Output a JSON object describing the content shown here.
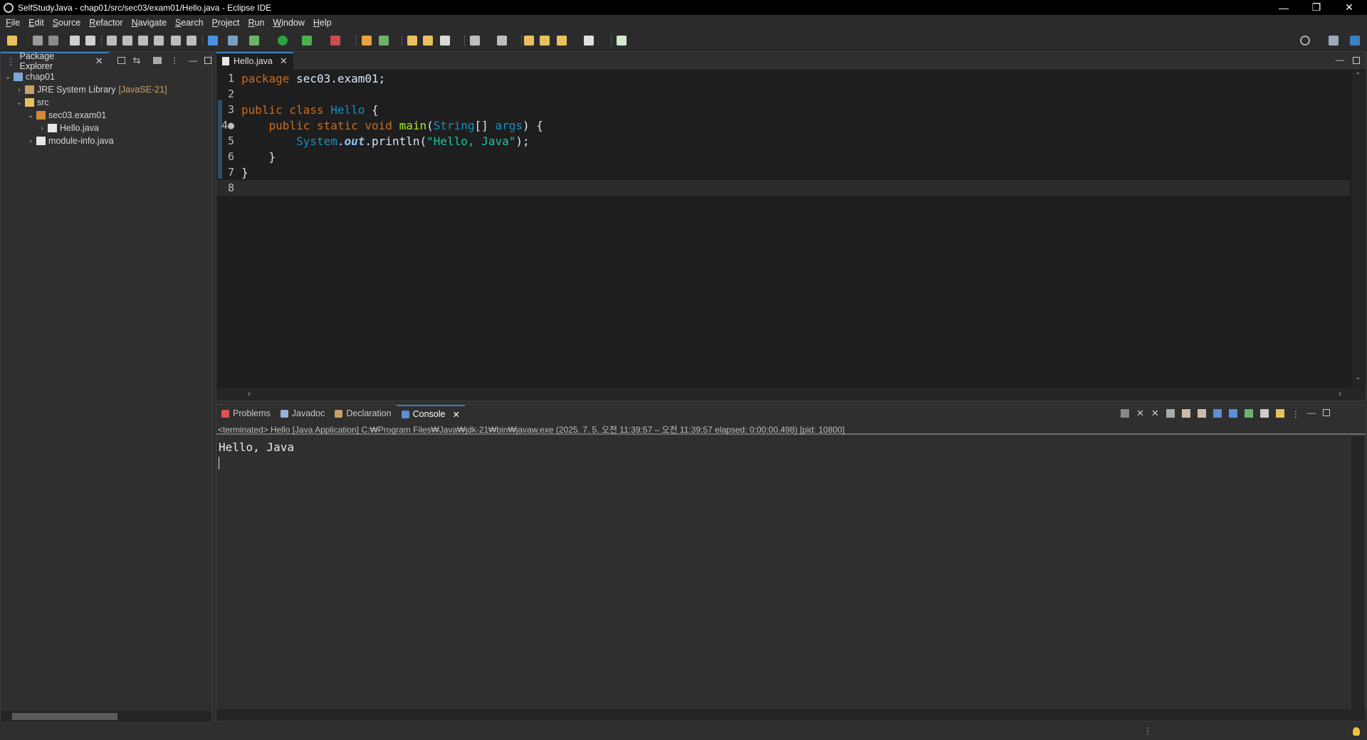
{
  "window": {
    "title": "SelfStudyJava - chap01/src/sec03/exam01/Hello.java - Eclipse IDE",
    "controls": [
      "—",
      "❐",
      "✕"
    ]
  },
  "menu": [
    "File",
    "Edit",
    "Source",
    "Refactor",
    "Navigate",
    "Search",
    "Project",
    "Run",
    "Window",
    "Help"
  ],
  "package_explorer": {
    "tab": "Package Explorer",
    "tree": [
      {
        "label": "chap01",
        "indent": 0,
        "twisty": "⌄",
        "icon": "java-project-icon"
      },
      {
        "label": "JRE System Library",
        "decoration": "[JavaSE-21]",
        "indent": 1,
        "twisty": "›",
        "icon": "library-icon"
      },
      {
        "label": "src",
        "indent": 1,
        "twisty": "⌄",
        "icon": "source-folder-icon"
      },
      {
        "label": "sec03.exam01",
        "indent": 2,
        "twisty": "⌄",
        "icon": "package-icon"
      },
      {
        "label": "Hello.java",
        "indent": 3,
        "twisty": "›",
        "icon": "java-file-icon"
      },
      {
        "label": "module-info.java",
        "indent": 2,
        "twisty": "›",
        "icon": "java-file-icon"
      }
    ]
  },
  "editor": {
    "tab": "Hello.java",
    "lines": [
      {
        "n": "1",
        "tokens": [
          [
            "kw",
            "package "
          ],
          [
            "pl",
            "sec03.exam01;"
          ]
        ]
      },
      {
        "n": "2",
        "tokens": []
      },
      {
        "n": "3",
        "tokens": [
          [
            "kw",
            "public class "
          ],
          [
            "ty",
            "Hello"
          ],
          [
            "pl",
            " {"
          ]
        ]
      },
      {
        "n": "4●",
        "tokens": [
          [
            "pl",
            "    "
          ],
          [
            "kw",
            "public static void "
          ],
          [
            "fn",
            "main"
          ],
          [
            "pl",
            "("
          ],
          [
            "ty",
            "String"
          ],
          [
            "pl",
            "[] "
          ],
          [
            "ty",
            "args"
          ],
          [
            "pl",
            ") {"
          ]
        ]
      },
      {
        "n": "5",
        "tokens": [
          [
            "pl",
            "        "
          ],
          [
            "ty",
            "System"
          ],
          [
            "pl",
            "."
          ],
          [
            "it",
            "out"
          ],
          [
            "pl",
            ".println("
          ],
          [
            "st",
            "\"Hello, Java\""
          ],
          [
            "pl",
            ");"
          ]
        ]
      },
      {
        "n": "6",
        "tokens": [
          [
            "pl",
            "    }"
          ]
        ]
      },
      {
        "n": "7",
        "tokens": [
          [
            "pl",
            "}"
          ]
        ]
      },
      {
        "n": "8",
        "tokens": []
      }
    ]
  },
  "bottom_tabs": [
    {
      "label": "Problems",
      "icon": "problems-icon",
      "color": "#d9534f"
    },
    {
      "label": "Javadoc",
      "icon": "javadoc-icon",
      "color": "#8fb4d9"
    },
    {
      "label": "Declaration",
      "icon": "declaration-icon",
      "color": "#c9a067"
    },
    {
      "label": "Console",
      "icon": "console-icon",
      "color": "#5b8fd6",
      "active": true
    }
  ],
  "console": {
    "info": "<terminated> Hello [Java Application] C:₩Program Files₩Java₩jdk-21₩bin₩javaw.exe  (2025. 7. 5. 오전 11:39:57 – 오전 11:39:57 elapsed: 0:00:00.498) [pid: 10800]",
    "output": "Hello, Java"
  }
}
